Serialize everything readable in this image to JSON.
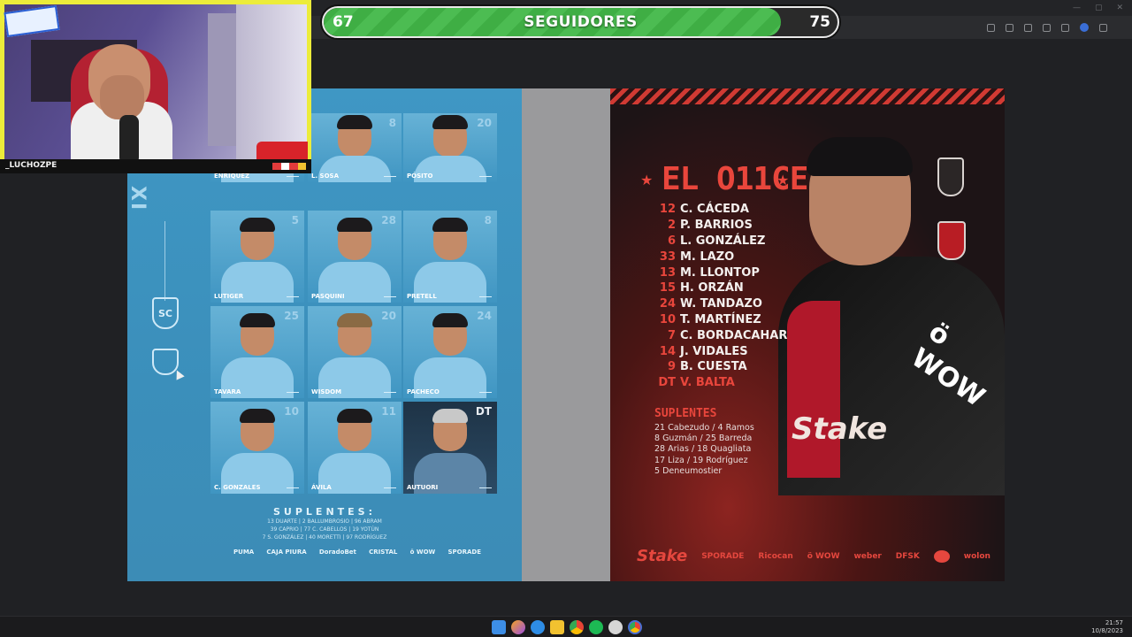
{
  "follow_bar": {
    "current": "67",
    "label": "SEGUIDORES",
    "goal": "75",
    "progress": 0.89
  },
  "webcam": {
    "streamer_name": "_LUCHOZPE"
  },
  "left_lineup": {
    "side_title": "XI DE",
    "players": [
      {
        "name": "ENRÍQUEZ",
        "number": ""
      },
      {
        "name": "L. SOSA",
        "number": "8"
      },
      {
        "name": "PÓSITO",
        "number": "20"
      },
      {
        "name": "LUTIGER",
        "number": "5"
      },
      {
        "name": "PASQUINI",
        "number": "28"
      },
      {
        "name": "PRETELL",
        "number": "8"
      },
      {
        "name": "TAVARA",
        "number": "25"
      },
      {
        "name": "WISDOM",
        "number": "20"
      },
      {
        "name": "PACHECO",
        "number": "24"
      },
      {
        "name": "C. GONZALES",
        "number": "10"
      },
      {
        "name": "ÁVILA",
        "number": "11"
      },
      {
        "name": "AUTUORI",
        "number": "DT"
      }
    ],
    "subs_title": "SUPLENTES:",
    "subs_lines": [
      "13 DUARTE | 2 BALLUMBROSIO | 96 ABRAM",
      "39 CAPRIO | 77 C. CABELLOS | 19 YOTÚN",
      "7 S. GONZÁLEZ | 40 MORETTI | 97 RODRÍGUEZ"
    ],
    "sponsors": [
      "PUMA",
      "CAJA PIURA",
      "DoradoBet",
      "CRISTAL",
      "ö WOW",
      "SPORADE"
    ]
  },
  "right_lineup": {
    "title": "EL O11CE",
    "roster": [
      {
        "num": "12",
        "name": "C. CÁCEDA"
      },
      {
        "num": "2",
        "name": "P. BARRIOS"
      },
      {
        "num": "6",
        "name": "L. GONZÁLEZ"
      },
      {
        "num": "33",
        "name": "M. LAZO"
      },
      {
        "num": "13",
        "name": "M. LLONTOP"
      },
      {
        "num": "15",
        "name": "H. ORZÁN"
      },
      {
        "num": "24",
        "name": "W. TANDAZO"
      },
      {
        "num": "10",
        "name": "T. MARTÍNEZ"
      },
      {
        "num": "7",
        "name": "C. BORDACAHAR"
      },
      {
        "num": "14",
        "name": "J. VIDALES"
      },
      {
        "num": "9",
        "name": "B. CUESTA"
      },
      {
        "num": "DT",
        "name": "V. BALTA"
      }
    ],
    "subs_title": "SUPLENTES",
    "subs": [
      "21 Cabezudo / 4 Ramos",
      "8 Guzmán / 25 Barreda",
      "28 Arias / 18 Quagliata",
      "17 Liza / 19 Rodríguez",
      "5 Deneumostier"
    ],
    "shirt_sponsor": "ö WOW",
    "chest_sponsor": "Stake",
    "sponsors": [
      "Stake",
      "SPORADE",
      "Ricocan",
      "ö WOW",
      "weber",
      "DFSK",
      "",
      "wolon"
    ]
  },
  "taskbar": {
    "time": "21:57",
    "date": "10/8/2023"
  }
}
